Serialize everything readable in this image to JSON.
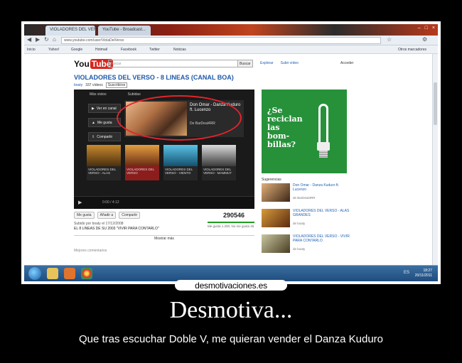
{
  "browser": {
    "tabs": [
      "VIOLADORES DEL VERSO",
      "YouTube - Broadcast..."
    ],
    "window_buttons": [
      "–",
      "□",
      "×"
    ],
    "url": "www.youtube.com/user/ViolaDelVerso",
    "bookmarks": [
      "Inicio",
      "Yahoo!",
      "Google",
      "Hotmail",
      "Facebook",
      "Twitter",
      "Noticias",
      "Otros marcadores"
    ]
  },
  "youtube": {
    "logo_you": "You",
    "logo_tube": "Tube",
    "search_placeholder": "Buscar",
    "search_button": "Buscar",
    "top_links": [
      "Explorar",
      "Subir vídeo"
    ],
    "sign_in": "Acceder",
    "channel_title": "VIOLADORES DEL VERSO - 8 LINEAS (CANAL BOA)",
    "channel_sub": {
      "user": "boaty",
      "videos": "337 vídeos",
      "subscribe": "Suscribirse"
    },
    "player": {
      "tabs": [
        "Más vistos",
        "Subidas"
      ],
      "side_buttons": [
        "Ver en canal",
        "Me gusta",
        "Compartir"
      ],
      "featured_title": "Don Omar - Danza Kuduro ft. Lucenzo",
      "featured_by": "De BarDeal4RR",
      "thumbs": [
        {
          "cap": "VIOLADORES DEL VERSO - ALAS"
        },
        {
          "cap": "VIOLADORES DEL VERSO"
        },
        {
          "cap": "VIOLADORES DEL VERSO - VIENTO"
        },
        {
          "cap": "VIOLADORES DEL VERSO - MAMMUT"
        }
      ],
      "time": "0:00 / 4:12"
    },
    "actions": [
      "Me gusta",
      "Añadir a",
      "Compartir"
    ],
    "views": "290546",
    "rating_text": "Me gusta 1.200, No me gusta 45",
    "desc_line1": "Subido por boaty el 17/12/2008",
    "desc_line2": "EL 8 LINEAS DE SU 2003 \"VIVIR PARA CONTARLO\"",
    "more": "Mostrar más",
    "comments": "Mejores comentarios",
    "ad_text": [
      "¿Se",
      "reciclan",
      "las",
      "bom-",
      "billas?"
    ],
    "suggestions_header": "Sugerencias",
    "suggestions": [
      {
        "title": "Don Omar - Danza Kuduro ft. Lucenzo",
        "meta": "de BarDeal4RR"
      },
      {
        "title": "VIOLADORES DEL VERSO - ALAS GRANDES",
        "meta": "de boaty"
      },
      {
        "title": "VIOLADORES DEL VERSO - VIVIR PARA CONTARLO",
        "meta": "de boaty"
      }
    ]
  },
  "taskbar": {
    "clock_time": "18:27",
    "clock_date": "20/11/2011",
    "tray": "ES"
  },
  "poster": {
    "site": "desmotivaciones.es",
    "headline": "Desmotiva...",
    "caption": "Que tras escuchar Doble V, me quieran vender el Danza Kuduro"
  }
}
